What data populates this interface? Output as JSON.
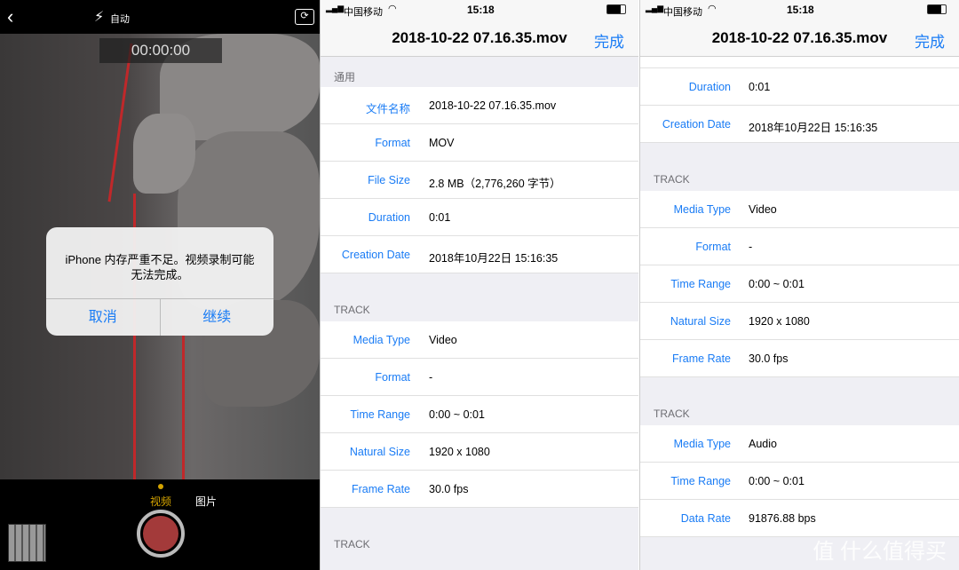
{
  "camera": {
    "flash_label": "自动",
    "timer": "00:00:00",
    "alert": {
      "message": "iPhone 内存严重不足。视频录制可能无法完成。",
      "cancel": "取消",
      "continue": "继续"
    },
    "modes": [
      "视频",
      "图片"
    ],
    "active_mode_color": "#d4a300",
    "shutter_color": "#a33a3a"
  },
  "status": {
    "carrier": "中国移动",
    "time": "15:18"
  },
  "nav": {
    "title": "2018-10-22 07.16.35.mov",
    "done": "完成"
  },
  "panel2": [
    {
      "header": "通用",
      "rows": [
        [
          "文件名称",
          "2018-10-22 07.16.35.mov"
        ],
        [
          "Format",
          "MOV"
        ],
        [
          "File Size",
          "2.8 MB（2,776,260 字节）"
        ],
        [
          "Duration",
          "0:01"
        ],
        [
          "Creation Date",
          "2018年10月22日 15:16:35"
        ]
      ]
    },
    {
      "header": "TRACK",
      "rows": [
        [
          "Media Type",
          "Video"
        ],
        [
          "Format",
          "-"
        ],
        [
          "Time Range",
          "0:00 ~ 0:01"
        ],
        [
          "Natural Size",
          "1920 x 1080"
        ],
        [
          "Frame Rate",
          "30.0 fps"
        ]
      ]
    },
    {
      "header": "TRACK",
      "rows": []
    }
  ],
  "panel3": [
    {
      "header": "",
      "rows": [
        [
          "Duration",
          "0:01"
        ],
        [
          "Creation Date",
          "2018年10月22日 15:16:35"
        ]
      ]
    },
    {
      "header": "TRACK",
      "rows": [
        [
          "Media Type",
          "Video"
        ],
        [
          "Format",
          "-"
        ],
        [
          "Time Range",
          "0:00 ~ 0:01"
        ],
        [
          "Natural Size",
          "1920 x 1080"
        ],
        [
          "Frame Rate",
          "30.0 fps"
        ]
      ]
    },
    {
      "header": "TRACK",
      "rows": [
        [
          "Media Type",
          "Audio"
        ],
        [
          "Time Range",
          "0:00 ~ 0:01"
        ],
        [
          "Data Rate",
          "91876.88 bps"
        ]
      ]
    }
  ],
  "watermark": "值 什么值得买",
  "accent": "#1a7cf5"
}
